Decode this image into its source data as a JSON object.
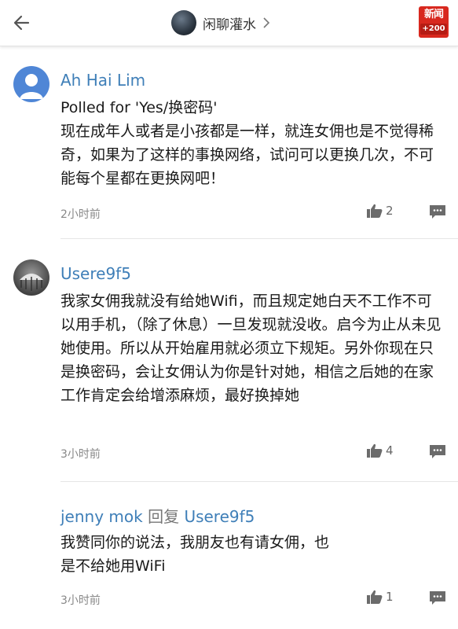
{
  "header": {
    "channel_name": "闲聊灌水",
    "logo_text": "新闻",
    "logo_badge": "+200"
  },
  "comments": [
    {
      "author": "Ah Hai Lim",
      "text": "Polled for 'Yes/换密码'\n现在成年人或者是小孩都是一样，就连女佣也是不觉得稀奇，如果为了这样的事换网络，试问可以更换几次，不可能每个星都在更换网吧！",
      "time": "2小时前",
      "likes": "2"
    },
    {
      "author": "Usere9f5",
      "text": "我家女佣我就没有给她Wifi，而且规定她白天不工作不可以用手机，（除了休息）一旦发现就没收。启今为止从未见她使用。所以从开始雇用就必须立下规矩。另外你现在只是换密码，会让女佣认为你是针对她，相信之后她的在家工作肯定会给增添麻烦，最好换掉她",
      "time": "3小时前",
      "likes": "4"
    },
    {
      "author": "jenny mok",
      "reply_word": "回复",
      "reply_to": "Usere9f5",
      "text": "我赞同你的说法，我朋友也有请女佣，也\n是不给她用WiFi",
      "time": "3小时前",
      "likes": "1"
    }
  ],
  "colors": {
    "author_blue": "#3f7fb8",
    "logo_red": "#d8281e",
    "icon_gray": "#6b6b6b"
  }
}
